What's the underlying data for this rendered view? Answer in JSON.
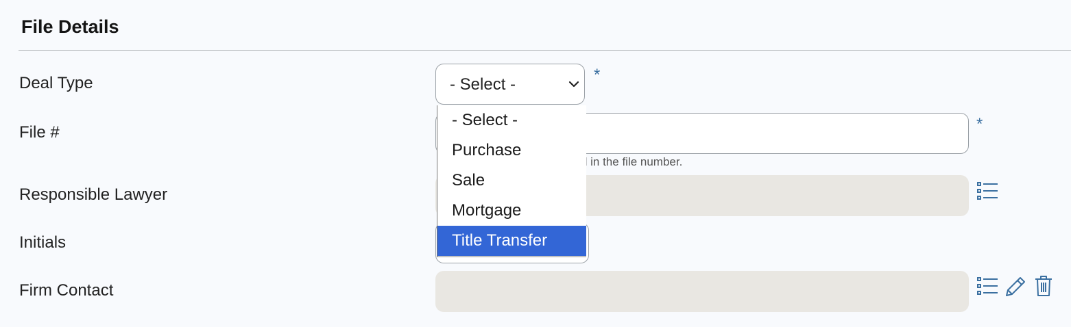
{
  "section": {
    "title": "File Details"
  },
  "fields": {
    "deal_type": {
      "label": "Deal Type",
      "value": "- Select -",
      "required": "*"
    },
    "file_number": {
      "label": "File #",
      "required": "*",
      "help": "ved in the file number."
    },
    "responsible_lawyer": {
      "label": "Responsible Lawyer"
    },
    "initials": {
      "label": "Initials"
    },
    "firm_contact": {
      "label": "Firm Contact"
    }
  },
  "dropdown": {
    "options": [
      "- Select -",
      "Purchase",
      "Sale",
      "Mortgage",
      "Title Transfer"
    ],
    "highlighted": "Title Transfer"
  },
  "colors": {
    "accent": "#3a6fa0",
    "highlight": "#3366d6",
    "readonly_bg": "#e9e7e2"
  },
  "icons": {
    "responsible_lawyer": [
      "list-icon"
    ],
    "firm_contact": [
      "list-icon",
      "pencil-icon",
      "trash-icon"
    ]
  }
}
